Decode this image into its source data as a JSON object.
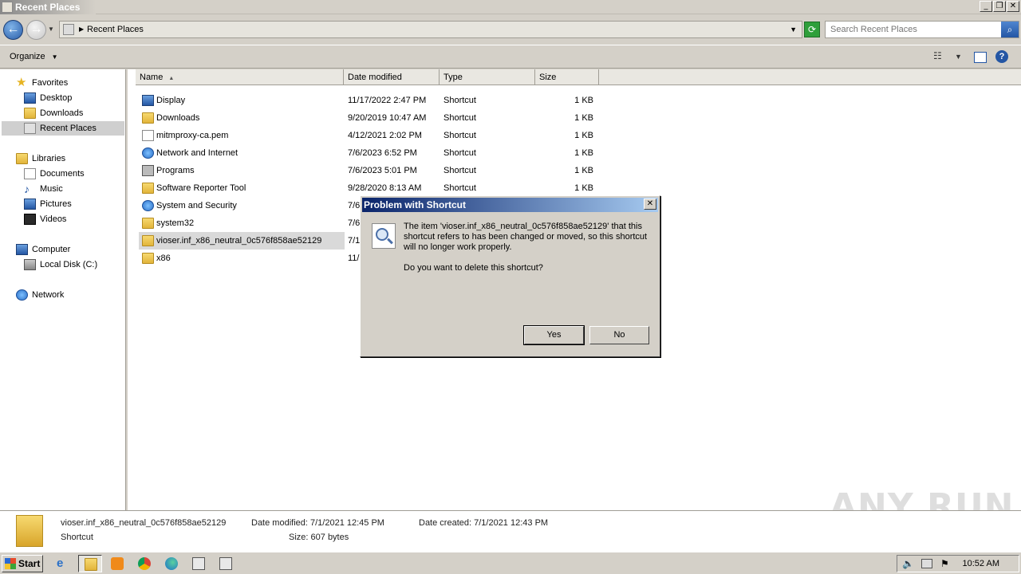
{
  "window": {
    "title": "Recent Places"
  },
  "address": {
    "path": "Recent Places",
    "search_placeholder": "Search Recent Places"
  },
  "toolbar": {
    "organize_label": "Organize"
  },
  "sidebar": {
    "favorites": {
      "label": "Favorites",
      "items": [
        {
          "label": "Desktop"
        },
        {
          "label": "Downloads"
        },
        {
          "label": "Recent Places"
        }
      ]
    },
    "libraries": {
      "label": "Libraries",
      "items": [
        {
          "label": "Documents"
        },
        {
          "label": "Music"
        },
        {
          "label": "Pictures"
        },
        {
          "label": "Videos"
        }
      ]
    },
    "computer": {
      "label": "Computer",
      "items": [
        {
          "label": "Local Disk (C:)"
        }
      ]
    },
    "network": {
      "label": "Network"
    }
  },
  "columns": {
    "name": "Name",
    "date": "Date modified",
    "type": "Type",
    "size": "Size"
  },
  "files": [
    {
      "name": "Display",
      "date": "11/17/2022 2:47 PM",
      "type": "Shortcut",
      "size": "1 KB",
      "icon": "display-icon"
    },
    {
      "name": "Downloads",
      "date": "9/20/2019 10:47 AM",
      "type": "Shortcut",
      "size": "1 KB",
      "icon": "folder-icon"
    },
    {
      "name": "mitmproxy-ca.pem",
      "date": "4/12/2021 2:02 PM",
      "type": "Shortcut",
      "size": "1 KB",
      "icon": "document-icon"
    },
    {
      "name": "Network and Internet",
      "date": "7/6/2023 6:52 PM",
      "type": "Shortcut",
      "size": "1 KB",
      "icon": "network-icon"
    },
    {
      "name": "Programs",
      "date": "7/6/2023 5:01 PM",
      "type": "Shortcut",
      "size": "1 KB",
      "icon": "programs-icon"
    },
    {
      "name": "Software Reporter Tool",
      "date": "9/28/2020 8:13 AM",
      "type": "Shortcut",
      "size": "1 KB",
      "icon": "folder-icon"
    },
    {
      "name": "System and Security",
      "date": "7/6",
      "type": "",
      "size": "",
      "icon": "security-icon"
    },
    {
      "name": "system32",
      "date": "7/6",
      "type": "",
      "size": "",
      "icon": "folder-icon"
    },
    {
      "name": "vioser.inf_x86_neutral_0c576f858ae52129",
      "date": "7/1",
      "type": "",
      "size": "",
      "icon": "folder-icon"
    },
    {
      "name": "x86",
      "date": "11/",
      "type": "",
      "size": "",
      "icon": "folder-icon"
    }
  ],
  "dialog": {
    "title": "Problem with Shortcut",
    "close": "✕",
    "message": "The item 'vioser.inf_x86_neutral_0c576f858ae52129' that this shortcut refers to has been changed or moved, so this shortcut will no longer work properly.",
    "question": "Do you want to delete this shortcut?",
    "yes_label": "Yes",
    "no_label": "No"
  },
  "details": {
    "name": "vioser.inf_x86_neutral_0c576f858ae52129",
    "type": "Shortcut",
    "modified_label": "Date modified:",
    "modified_value": "7/1/2021 12:45 PM",
    "created_label": "Date created:",
    "created_value": "7/1/2021 12:43 PM",
    "size_label": "Size:",
    "size_value": "607 bytes"
  },
  "watermark": "ANY RUN",
  "taskbar": {
    "start_label": "Start",
    "clock": "10:52 AM",
    "apps": [
      "internet-explorer-icon",
      "explorer-icon",
      "media-player-icon",
      "chrome-icon",
      "edge-icon",
      "window-icon",
      "window-icon"
    ]
  }
}
